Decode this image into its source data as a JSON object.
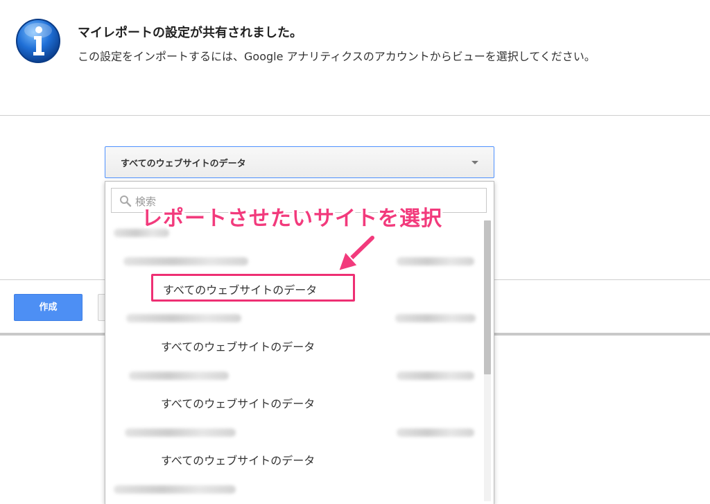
{
  "info": {
    "title": "マイレポートの設定が共有されました。",
    "text": "この設定をインポートするには、Google アナリティクスのアカウントからビューを選択してください。",
    "icon": "info-icon"
  },
  "view_select": {
    "selected": "すべてのウェブサイトのデータ",
    "arrow_icon": "chevron-down-icon"
  },
  "dropdown": {
    "search_placeholder": "検索",
    "items": [
      {
        "type": "account",
        "label": ""
      },
      {
        "type": "property",
        "label": ""
      },
      {
        "type": "view",
        "label": "すべてのウェブサイトのデータ",
        "highlighted": true
      },
      {
        "type": "property",
        "label": ""
      },
      {
        "type": "view",
        "label": "すべてのウェブサイトのデータ"
      },
      {
        "type": "property",
        "label": ""
      },
      {
        "type": "view",
        "label": "すべてのウェブサイトのデータ"
      },
      {
        "type": "property",
        "label": ""
      },
      {
        "type": "view",
        "label": "すべてのウェブサイトのデータ"
      },
      {
        "type": "account",
        "label": ""
      }
    ]
  },
  "buttons": {
    "create": "作成"
  },
  "annotation": {
    "callout": "レポートさせたいサイトを選択",
    "color": "#f23a7c"
  }
}
